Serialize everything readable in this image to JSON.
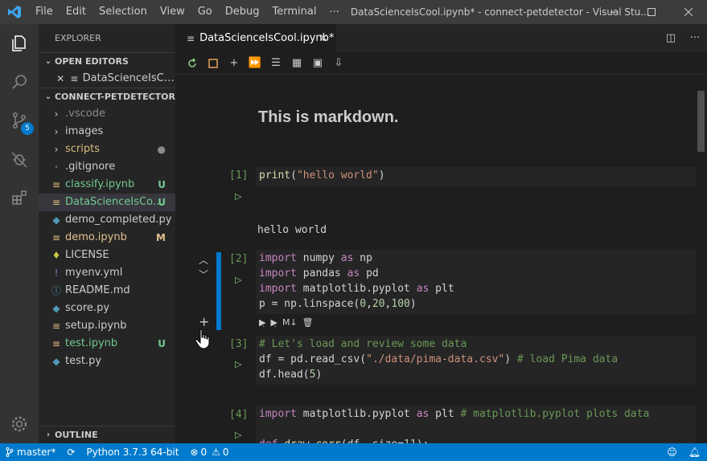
{
  "titlebar": {
    "menu": [
      "File",
      "Edit",
      "Selection",
      "View",
      "Go",
      "Debug",
      "Terminal"
    ],
    "more": "···",
    "title": "DataScienceIsCool.ipynb* - connect-petdetector - Visual Stu..."
  },
  "activity": {
    "scm_badge": "5"
  },
  "sidebar": {
    "title": "EXPLORER",
    "open_editors_label": "OPEN EDITORS",
    "open_editor_file": "DataScienceIsCoo...",
    "project_label": "CONNECT-PETDETECTOR",
    "files": [
      {
        "label": ".vscode",
        "status": "",
        "color": "#8b8b8b",
        "icon": "chevron-right-icon"
      },
      {
        "label": "images",
        "status": "",
        "color": "#cccccc",
        "icon": "chevron-right-icon"
      },
      {
        "label": "scripts",
        "status": "●",
        "color": "#d7ba7d",
        "icon": "chevron-right-icon"
      },
      {
        "label": ".gitignore",
        "status": "",
        "color": "#cccccc",
        "icon": "file-icon"
      },
      {
        "label": "classify.ipynb",
        "status": "U",
        "color": "#73c991",
        "icon": "notebook-icon"
      },
      {
        "label": "DataScienceIsCo...",
        "status": "U",
        "color": "#73c991",
        "icon": "notebook-icon"
      },
      {
        "label": "demo_completed.py",
        "status": "",
        "color": "#cccccc",
        "icon": "python-icon"
      },
      {
        "label": "demo.ipynb",
        "status": "M",
        "color": "#e2c08d",
        "icon": "notebook-icon"
      },
      {
        "label": "LICENSE",
        "status": "",
        "color": "#cccccc",
        "icon": "license-icon"
      },
      {
        "label": "myenv.yml",
        "status": "",
        "color": "#cccccc",
        "icon": "yaml-icon"
      },
      {
        "label": "README.md",
        "status": "",
        "color": "#cccccc",
        "icon": "info-icon"
      },
      {
        "label": "score.py",
        "status": "",
        "color": "#cccccc",
        "icon": "python-icon"
      },
      {
        "label": "setup.ipynb",
        "status": "",
        "color": "#cccccc",
        "icon": "notebook-icon"
      },
      {
        "label": "test.ipynb",
        "status": "U",
        "color": "#73c991",
        "icon": "notebook-icon"
      },
      {
        "label": "test.py",
        "status": "",
        "color": "#cccccc",
        "icon": "python-icon"
      }
    ],
    "outline_label": "OUTLINE"
  },
  "editor": {
    "tab_label": "DataScienceIsCool.ipynb*",
    "markdown_text": "This is markdown.",
    "cells": [
      {
        "count": "[1]",
        "output": "hello world"
      },
      {
        "count": "[2]"
      },
      {
        "count": "[3]"
      },
      {
        "count": "[4]"
      }
    ],
    "cell_toolbar_md": "M↓"
  },
  "statusbar": {
    "branch": "master*",
    "python": "Python 3.7.3 64-bit",
    "errors": "0",
    "warnings": "0"
  },
  "colors": {
    "accent": "#007acc",
    "untracked": "#73c991",
    "modified": "#e2c08d"
  }
}
